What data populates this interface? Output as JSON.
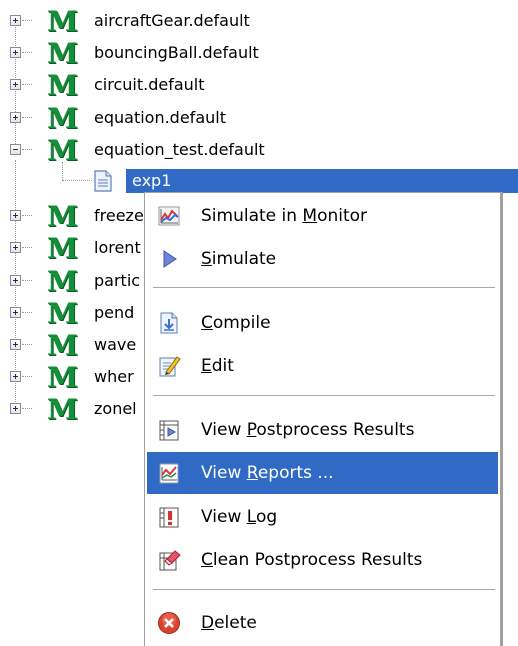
{
  "tree": {
    "nodes": [
      {
        "label": "aircraftGear.default"
      },
      {
        "label": "bouncingBall.default"
      },
      {
        "label": "circuit.default"
      },
      {
        "label": "equation.default"
      },
      {
        "label": "equation_test.default"
      },
      {
        "label": "freeze"
      },
      {
        "label": "lorent"
      },
      {
        "label": "partic"
      },
      {
        "label": "pend"
      },
      {
        "label": "wave"
      },
      {
        "label": "wher"
      },
      {
        "label": "zonel"
      }
    ],
    "model_glyph": "M",
    "child": {
      "label": "exp1"
    }
  },
  "context_menu": {
    "items": [
      {
        "pre": "Simulate in ",
        "u": "M",
        "post": "onitor",
        "icon": "monitor-chart-icon"
      },
      {
        "pre": "",
        "u": "S",
        "post": "imulate",
        "icon": "play-triangle-icon"
      },
      {
        "pre": "",
        "u": "C",
        "post": "ompile",
        "icon": "compile-icon"
      },
      {
        "pre": "",
        "u": "E",
        "post": "dit",
        "icon": "edit-pencil-icon"
      },
      {
        "pre": "View ",
        "u": "P",
        "post": "ostprocess Results",
        "icon": "postprocess-icon"
      },
      {
        "pre": "View ",
        "u": "R",
        "post": "eports ...",
        "icon": "reports-chart-icon"
      },
      {
        "pre": "View ",
        "u": "L",
        "post": "og",
        "icon": "log-icon"
      },
      {
        "pre": "",
        "u": "C",
        "post": "lean Postprocess Results",
        "icon": "clean-eraser-icon"
      },
      {
        "pre": "",
        "u": "D",
        "post": "elete",
        "icon": "delete-icon"
      }
    ],
    "highlighted": "View Reports ..."
  },
  "colors": {
    "selection": "#316ac5",
    "model_icon": "#168f3a",
    "delete_red": "#d9432c"
  }
}
